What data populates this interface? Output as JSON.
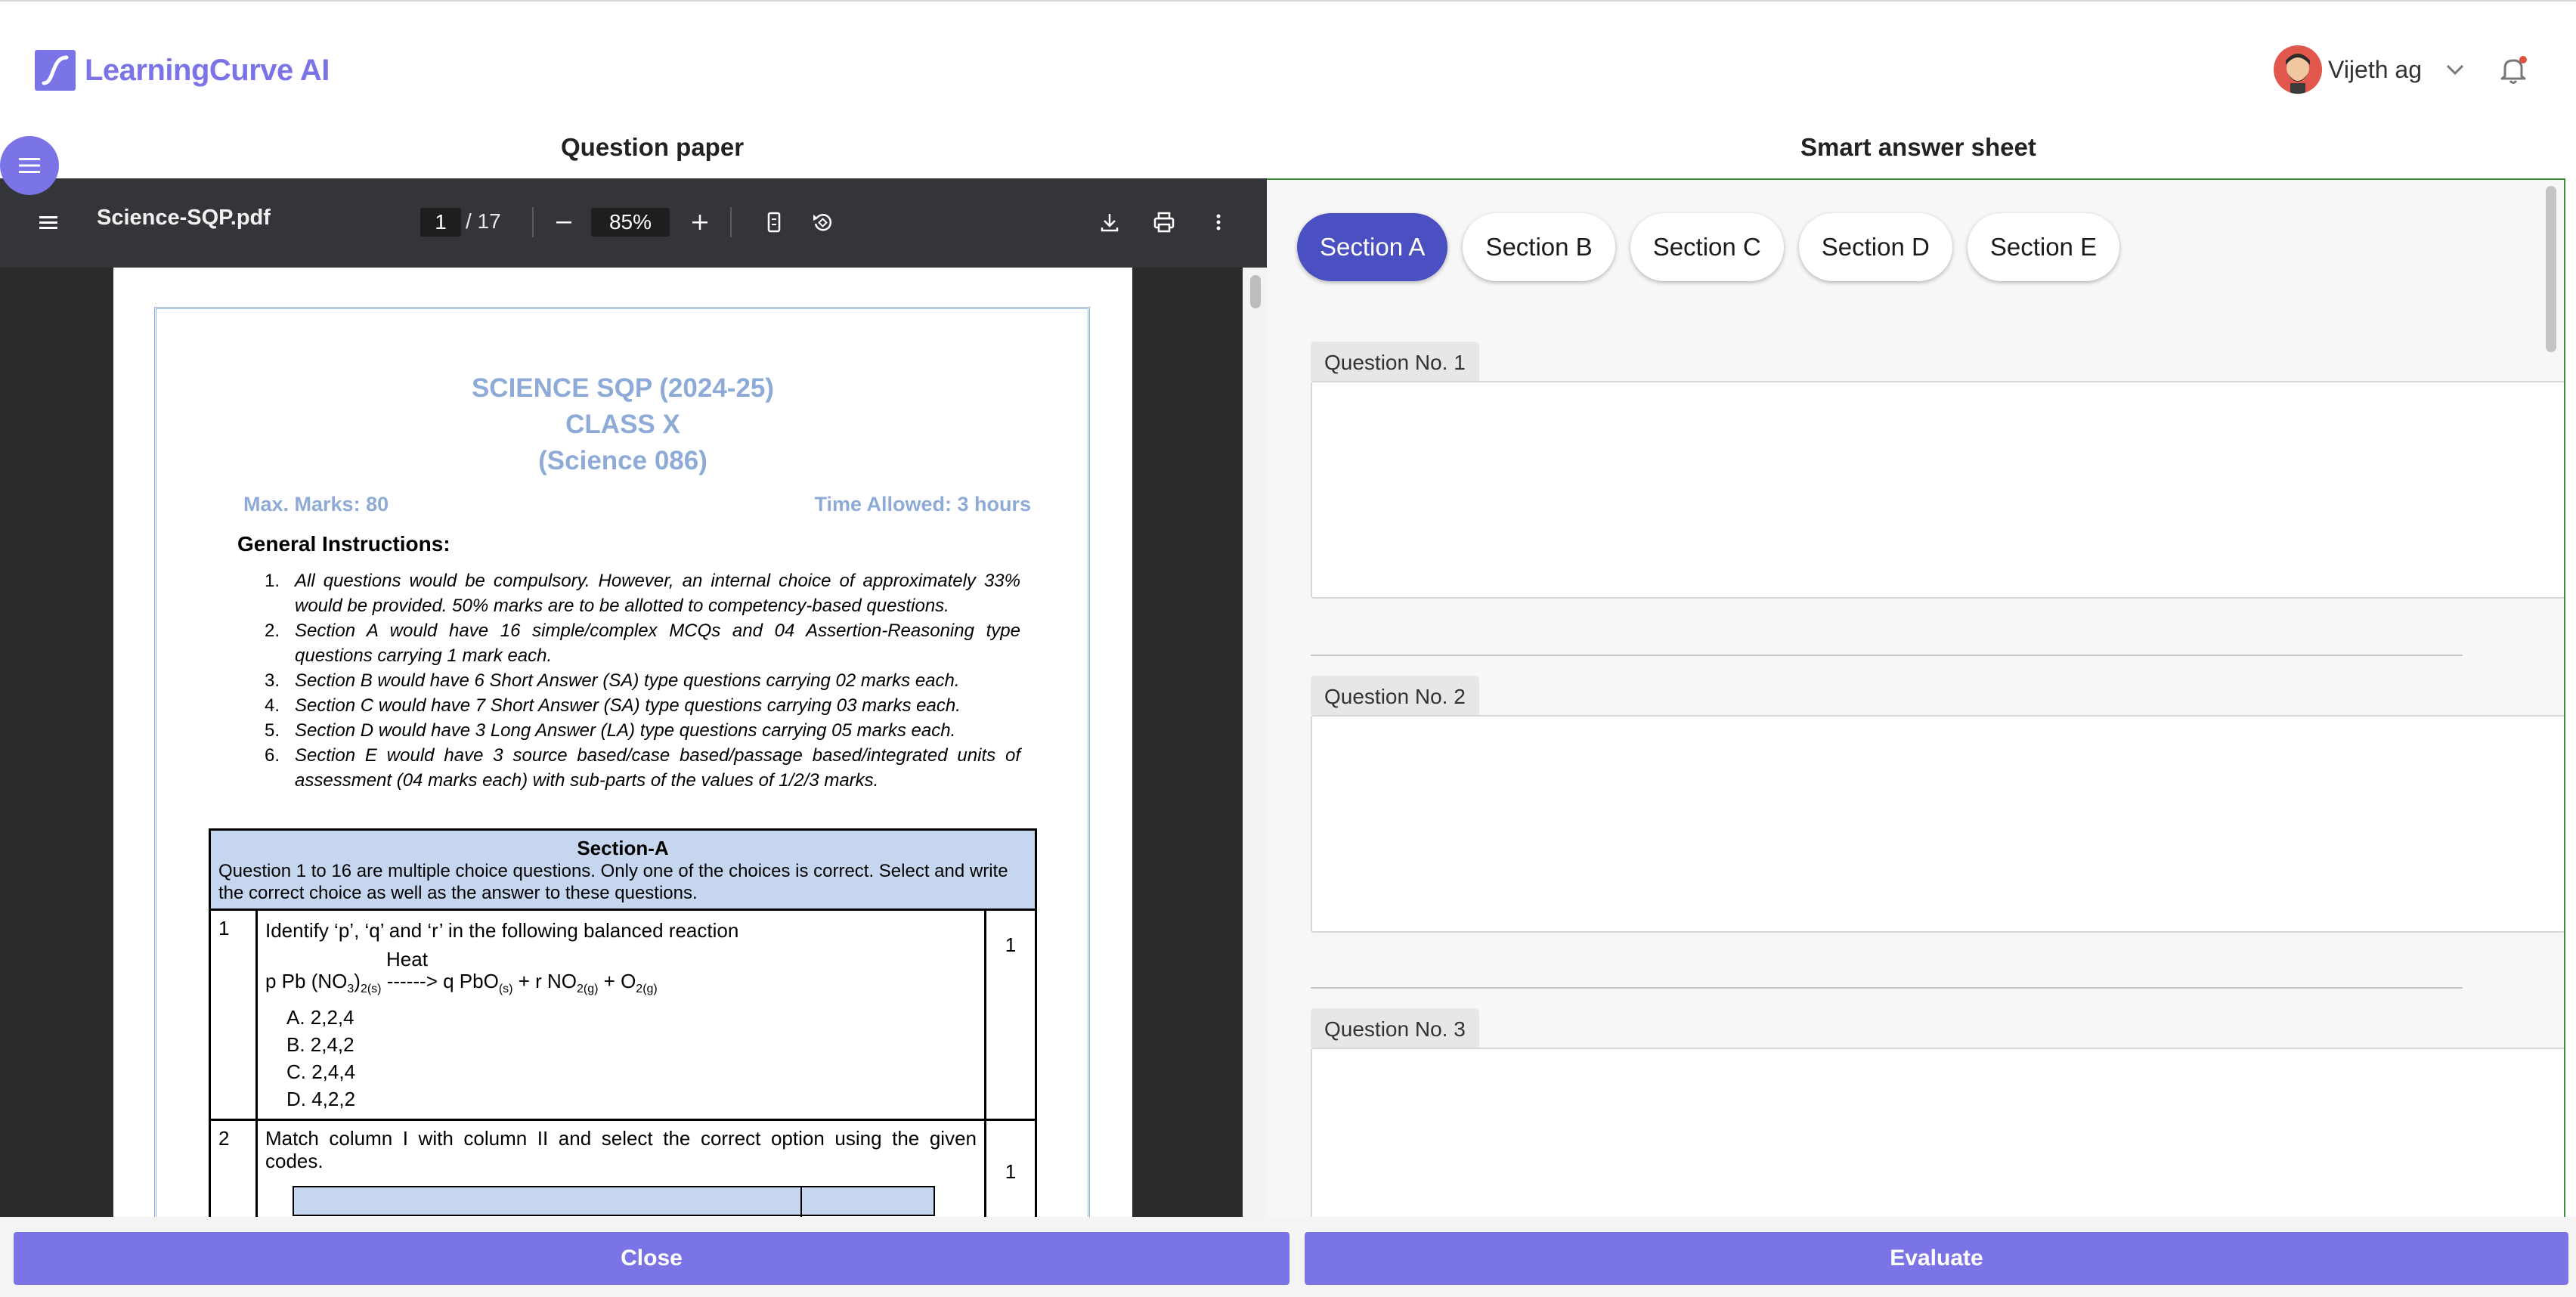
{
  "app": {
    "brand": "LearningCurve AI",
    "brand_color": "#7b74e6",
    "user_name": "Vijeth ag"
  },
  "panes": {
    "left_title": "Question paper",
    "right_title": "Smart answer sheet"
  },
  "pdf_viewer": {
    "filename": "Science-SQP.pdf",
    "current_page": "1",
    "total_pages": "/ 17",
    "zoom": "85%",
    "icons": [
      "menu-icon",
      "zoom-out-icon",
      "zoom-in-icon",
      "fit-page-icon",
      "rotate-icon",
      "download-icon",
      "print-icon",
      "more-vert-icon"
    ]
  },
  "document": {
    "title_line1": "SCIENCE SQP (2024-25)",
    "title_line2": "CLASS X",
    "title_line3": "(Science 086)",
    "max_marks": "Max. Marks: 80",
    "time_allowed": "Time Allowed: 3 hours",
    "general_instructions": "General Instructions:",
    "instructions": [
      {
        "num": "1.",
        "text": "All questions would be compulsory. However, an internal choice of approximately 33% would be provided. 50% marks are to be allotted to competency-based questions."
      },
      {
        "num": "2.",
        "text": "Section A would have 16 simple/complex MCQs and 04 Assertion-Reasoning type questions carrying 1 mark each."
      },
      {
        "num": "3.",
        "text": "Section B would have 6 Short Answer (SA) type questions carrying 02 marks each."
      },
      {
        "num": "4.",
        "text": "Section C would have 7 Short Answer (SA) type questions carrying 03 marks each."
      },
      {
        "num": "5.",
        "text": "Section D would have 3 Long Answer (LA) type questions carrying 05 marks each."
      },
      {
        "num": "6.",
        "text": "Section E would have 3 source based/case based/passage based/integrated units of assessment (04 marks each) with sub-parts of the values of 1/2/3 marks."
      }
    ],
    "section_title": "Section-A",
    "section_desc": "Question 1 to 16 are multiple choice questions. Only one of the choices is correct. Select and write the correct choice as well as the answer to these questions.",
    "q1": {
      "num": "1",
      "text": "Identify ‘p’, ‘q’ and ‘r’ in the following balanced reaction",
      "heat": "Heat",
      "options": [
        "A.  2,2,4",
        "B.  2,4,2",
        "C.  2,4,4",
        "D.  4,2,2"
      ],
      "marks": "1"
    },
    "q2": {
      "num": "2",
      "text": "Match column I with column II and select the correct option using the given codes.",
      "marks": "1"
    }
  },
  "answer_sheet": {
    "sections": [
      "Section A",
      "Section B",
      "Section C",
      "Section D",
      "Section E"
    ],
    "active_section": "Section A",
    "questions": [
      "Question No. 1",
      "Question No. 2",
      "Question No. 3"
    ]
  },
  "footer": {
    "close_label": "Close",
    "evaluate_label": "Evaluate"
  }
}
